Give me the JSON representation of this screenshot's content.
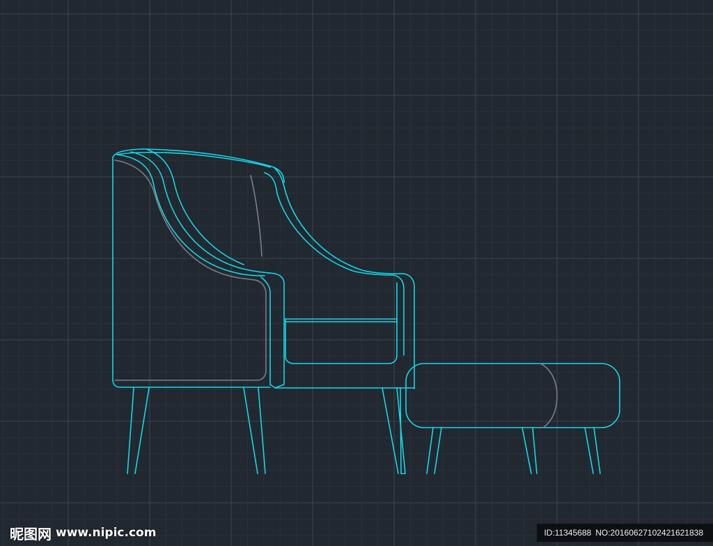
{
  "colors": {
    "background": "#212830",
    "grid_major": "#3a4350",
    "grid_minor": "#2a313b",
    "outline": "#14d9e8",
    "inner_line": "#7c8088",
    "watermark_text": "#ffffff",
    "id_strip_bg": "#0d0f12"
  },
  "watermark": {
    "logo_text": "昵图网",
    "url": "www.nipic.com"
  },
  "image_id": {
    "id_text": "ID:11345688",
    "no_text": "NO:20160627102421621838"
  }
}
